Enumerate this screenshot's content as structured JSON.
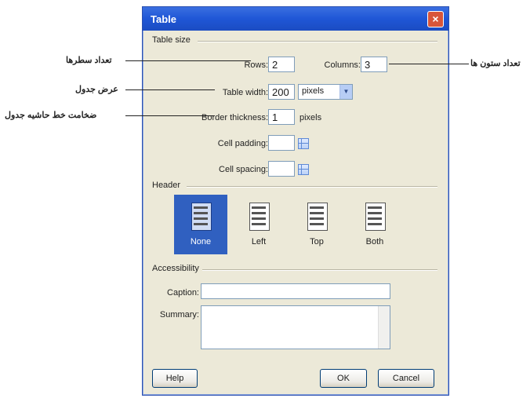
{
  "dialog": {
    "title": "Table"
  },
  "table_size": {
    "group_label": "Table size",
    "rows_label": "Rows:",
    "rows_value": "2",
    "columns_label": "Columns:",
    "columns_value": "3",
    "width_label": "Table width:",
    "width_value": "200",
    "width_unit": "pixels",
    "border_label": "Border thickness:",
    "border_value": "1",
    "border_unit": "pixels",
    "padding_label": "Cell padding:",
    "padding_value": "",
    "spacing_label": "Cell spacing:",
    "spacing_value": ""
  },
  "header": {
    "group_label": "Header",
    "options": [
      {
        "label": "None",
        "selected": true
      },
      {
        "label": "Left",
        "selected": false
      },
      {
        "label": "Top",
        "selected": false
      },
      {
        "label": "Both",
        "selected": false
      }
    ]
  },
  "accessibility": {
    "group_label": "Accessibility",
    "caption_label": "Caption:",
    "caption_value": "",
    "summary_label": "Summary:",
    "summary_value": ""
  },
  "buttons": {
    "help": "Help",
    "ok": "OK",
    "cancel": "Cancel"
  },
  "annotations": {
    "rows": "تعداد سطرها",
    "columns": "تعداد ستون ها",
    "width": "عرض جدول",
    "border": "ضخامت خط حاشیه جدول"
  },
  "colors": {
    "titlebar": "#1f56d6",
    "selected_header": "#3060c0",
    "dialog_bg": "#ece9d8"
  }
}
